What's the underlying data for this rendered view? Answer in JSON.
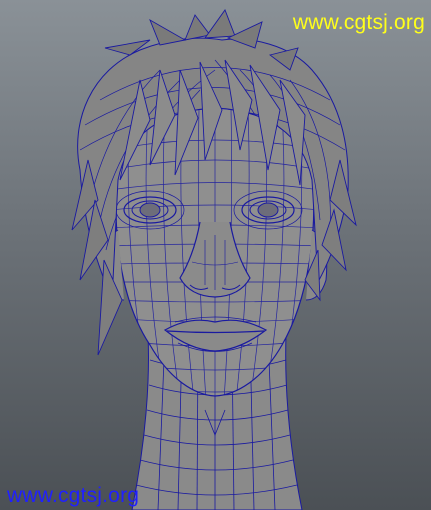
{
  "watermarks": {
    "top_right": "www.cgtsj.org",
    "bottom_left": "www.cgtsj.org"
  },
  "colors": {
    "background_top": "#8a9197",
    "background_bottom": "#4b5055",
    "mesh_fill": "#8e8e8e",
    "wireframe": "#1a1aa0",
    "watermark_top": "#ffff1a",
    "watermark_bottom": "#2020ff"
  },
  "scene": {
    "subject": "head-wireframe-model"
  }
}
